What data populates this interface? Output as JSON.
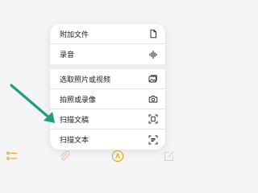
{
  "menu": {
    "groups": [
      {
        "items": [
          {
            "label": "附加文件",
            "icon": "document-icon"
          },
          {
            "label": "录音",
            "icon": "waveform-icon"
          }
        ]
      },
      {
        "items": [
          {
            "label": "选取照片或视频",
            "icon": "photo-library-icon"
          },
          {
            "label": "拍照或录像",
            "icon": "camera-icon"
          },
          {
            "label": "扫描文稿",
            "icon": "document-scan-icon"
          },
          {
            "label": "扫描文本",
            "icon": "text-scan-icon"
          }
        ]
      }
    ]
  },
  "toolbar": {
    "items": [
      {
        "icon": "checklist-icon"
      },
      {
        "icon": "paperclip-icon"
      },
      {
        "icon": "pen-markup-icon"
      },
      {
        "icon": "compose-icon"
      }
    ]
  },
  "colors": {
    "accent": "#e8a200",
    "arrow": "#1f9e7f",
    "text": "#1c1c1e",
    "background": "#f5f5f7"
  }
}
